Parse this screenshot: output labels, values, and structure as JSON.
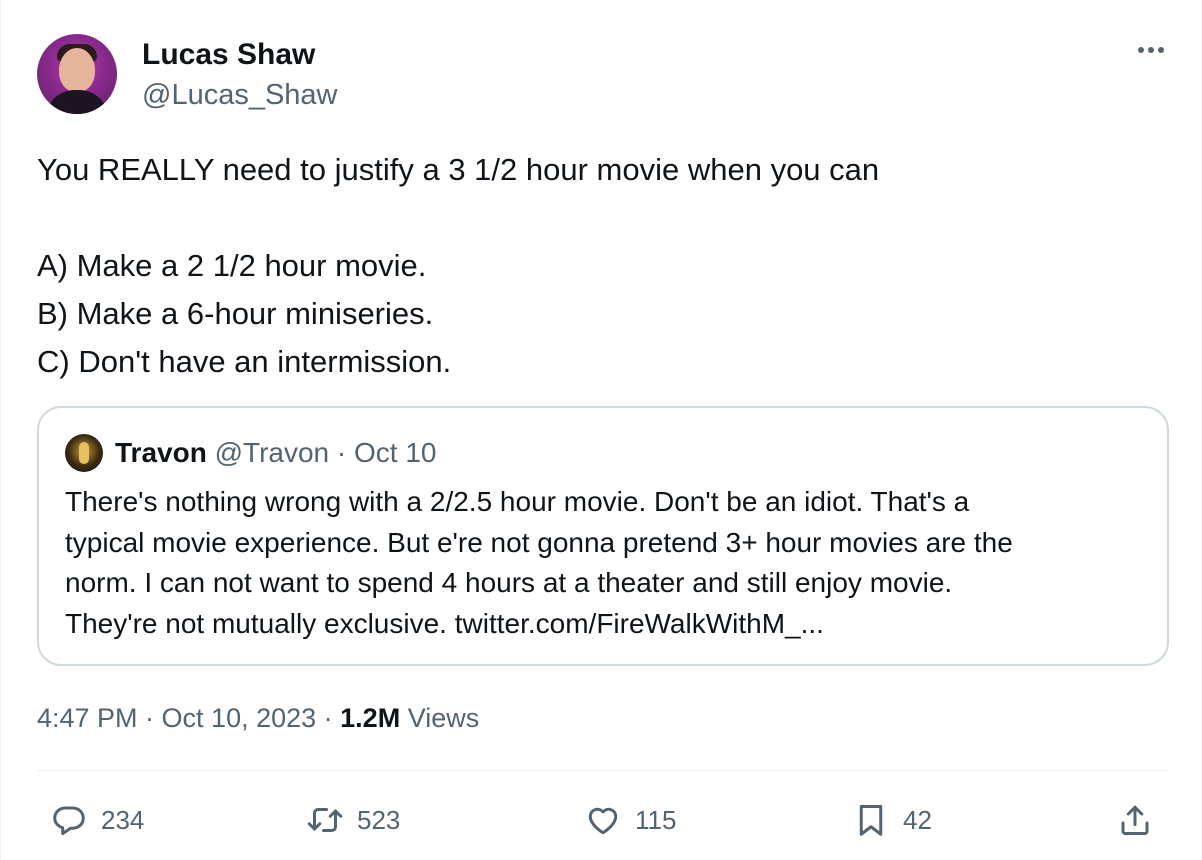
{
  "author": {
    "name": "Lucas Shaw",
    "handle": "@Lucas_Shaw"
  },
  "tweet": {
    "lines": [
      "You REALLY need to justify a 3 1/2 hour movie when you can",
      "A) Make a 2 1/2 hour movie.",
      "B) Make a 6-hour miniseries.",
      "C) Don't have an intermission."
    ]
  },
  "quote": {
    "name": "Travon",
    "meta": "@Travon · Oct 10",
    "lines": [
      "There's nothing wrong with a 2/2.5 hour movie. Don't be an idiot. That's a",
      "typical movie experience. But e're not gonna pretend 3+ hour movies are the",
      "norm. I can not want to spend 4 hours at a theater and still enjoy movie.",
      "They're not mutually exclusive. twitter.com/FireWalkWithM_..."
    ]
  },
  "meta": {
    "timestamp": "4:47 PM · Oct 10, 2023 · ",
    "views_count": "1.2M",
    "views_label": " Views"
  },
  "actions": {
    "replies": "234",
    "retweets": "523",
    "likes": "115",
    "bookmarks": "42"
  },
  "icons": {
    "more": "more-horizontal-icon",
    "reply": "reply-icon",
    "retweet": "retweet-icon",
    "like": "heart-icon",
    "bookmark": "bookmark-icon",
    "share": "share-icon"
  },
  "colors": {
    "text": "#0f1419",
    "secondary": "#536471",
    "border": "#cfd9de"
  }
}
